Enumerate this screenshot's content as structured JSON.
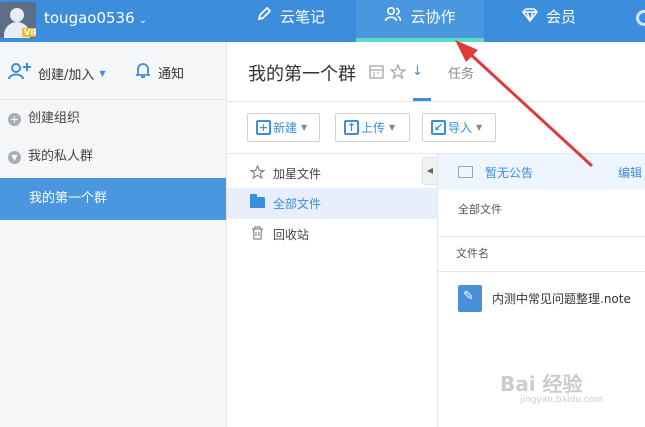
{
  "header": {
    "username": "tougao0536",
    "vip_badge": "VIP",
    "nav": [
      {
        "label": "云笔记",
        "icon": "pencil-icon"
      },
      {
        "label": "云协作",
        "icon": "people-icon"
      },
      {
        "label": "会员",
        "icon": "diamond-icon"
      }
    ],
    "active_nav": "云协作",
    "accent_color": "#3c8ddb"
  },
  "sidebar": {
    "create_join": "创建/加入",
    "notify": "通知",
    "items": [
      {
        "label": "创建组织",
        "icon": "plus-circle-icon"
      },
      {
        "label": "我的私人群",
        "icon": "chevron-down-circle-icon"
      }
    ],
    "active_group": "我的第一个群"
  },
  "main": {
    "group_title": "我的第一个群",
    "tab_task": "任务",
    "toolbar": {
      "new": "新建",
      "upload": "上传",
      "import": "导入"
    },
    "tree": {
      "starred": "加星文件",
      "all": "全部文件",
      "trash": "回收站"
    },
    "notice": {
      "text": "暂无公告",
      "edit": "编辑"
    },
    "breadcrumb": "全部文件",
    "column_name": "文件名",
    "files": [
      {
        "name": "内测中常见问题整理.note"
      }
    ]
  },
  "watermark": {
    "main": "Bai 经验",
    "sub": "jingyan.baidu.com"
  }
}
